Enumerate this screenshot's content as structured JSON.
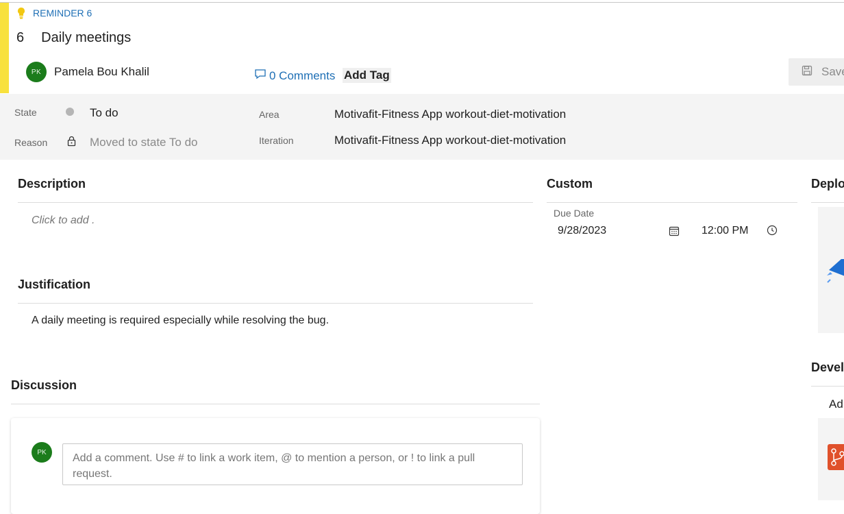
{
  "header": {
    "work_item_type": "REMINDER 6",
    "id": "6",
    "title": "Daily meetings",
    "assignee": {
      "initials": "PK",
      "name": "Pamela Bou Khalil"
    },
    "comments_label": "0 Comments",
    "add_tag_label": "Add Tag",
    "save_label": "Save"
  },
  "fields": {
    "state_label": "State",
    "state_value": "To do",
    "reason_label": "Reason",
    "reason_value": "Moved to state To do",
    "area_label": "Area",
    "area_value": "Motivafit-Fitness App workout-diet-motivation",
    "iteration_label": "Iteration",
    "iteration_value": "Motivafit-Fitness App workout-diet-motivation"
  },
  "description": {
    "title": "Description",
    "placeholder": "Click to add ."
  },
  "justification": {
    "title": "Justification",
    "text": "A daily meeting is required especially while resolving the bug."
  },
  "custom": {
    "title": "Custom",
    "due_date_label": "Due Date",
    "due_date": "9/28/2023",
    "due_time": "12:00 PM"
  },
  "deployment": {
    "title": "Deplo"
  },
  "development": {
    "title": "Devel",
    "add_link": "Ad"
  },
  "discussion": {
    "title": "Discussion",
    "avatar_initials": "PK",
    "comment_placeholder": "Add a comment. Use # to link a work item, @ to mention a person, or ! to link a pull request."
  },
  "colors": {
    "accent": "#f8e13d",
    "link": "#1e6fb5",
    "avatar": "#1b7c1b"
  }
}
